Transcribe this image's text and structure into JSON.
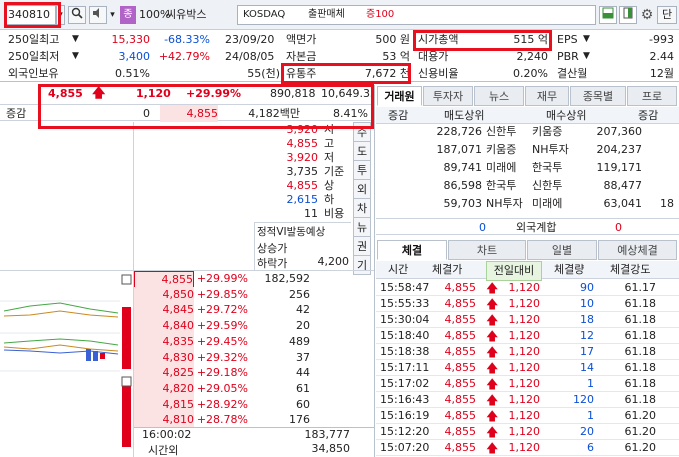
{
  "toolbar": {
    "code": "340810",
    "zoom_badge": "종",
    "zoom": "100%",
    "stock_name": "씨유박스",
    "market": "KOSDAQ",
    "sector": "출판매체",
    "margin": "증100",
    "unit_label": "단"
  },
  "info": {
    "r1": {
      "l1": "250일최고",
      "v1": "15,330",
      "p1": "-68.33%",
      "d1": "23/09/20",
      "l2": "액면가",
      "v2": "500 원",
      "l3": "시가총액",
      "v3": "515 억",
      "l4": "EPS",
      "v4": "-993"
    },
    "r2": {
      "l1": "250일최저",
      "v1": "3,400",
      "p1": "+42.79%",
      "d1": "24/08/05",
      "l2": "자본금",
      "v2": "53 억",
      "l3": "대용가",
      "v3": "2,240",
      "l4": "PBR",
      "v4": "2.44"
    },
    "r3": {
      "l1": "외국인보유",
      "v1": "0.51%",
      "v1b": "55(천)",
      "l2": "유통주",
      "v2": "7,672 천",
      "l3": "신용비율",
      "v3": "0.20%",
      "l4": "결산월",
      "v4": "12월"
    }
  },
  "price": {
    "current": "4,855",
    "change": "1,120",
    "rate": "+29.99%",
    "volume": "890,818",
    "value": "10,649.35",
    "vol_label": "증감",
    "vol_zero": "0",
    "price2": "4,855",
    "amount": "4,182백만",
    "ratio": "8.41%"
  },
  "summary": [
    {
      "v": "3,920",
      "l": "시",
      "c": "red"
    },
    {
      "v": "4,855",
      "l": "고",
      "c": "red"
    },
    {
      "v": "3,920",
      "l": "저",
      "c": "red"
    },
    {
      "v": "3,735",
      "l": "기준",
      "c": "dark"
    },
    {
      "v": "4,855",
      "l": "상",
      "c": "red"
    },
    {
      "v": "2,615",
      "l": "하",
      "c": "blue"
    },
    {
      "v": "11",
      "l": "비용",
      "c": "dark"
    }
  ],
  "vi": {
    "title": "정적VI발동예상",
    "up_label": "상승가",
    "down_label": "하락가",
    "down_value": "4,200"
  },
  "side_tabs": [
    "수",
    "도",
    "투",
    "외",
    "차",
    "뉴",
    "권",
    "기"
  ],
  "asks": [
    {
      "price": "4,855",
      "rate": "+29.99%",
      "qty": "182,592"
    },
    {
      "price": "4,850",
      "rate": "+29.85%",
      "qty": "256"
    },
    {
      "price": "4,845",
      "rate": "+29.72%",
      "qty": "42"
    },
    {
      "price": "4,840",
      "rate": "+29.59%",
      "qty": "20"
    },
    {
      "price": "4,835",
      "rate": "+29.45%",
      "qty": "489"
    },
    {
      "price": "4,830",
      "rate": "+29.32%",
      "qty": "37"
    },
    {
      "price": "4,825",
      "rate": "+29.18%",
      "qty": "44"
    },
    {
      "price": "4,820",
      "rate": "+29.05%",
      "qty": "61"
    },
    {
      "price": "4,815",
      "rate": "+28.92%",
      "qty": "60"
    },
    {
      "price": "4,810",
      "rate": "+28.78%",
      "qty": "176"
    }
  ],
  "ob_footer": {
    "time": "16:00:02",
    "total": "183,777",
    "label": "시간외",
    "after": "34,850"
  },
  "broker_tabs": [
    "거래원",
    "투자자",
    "뉴스",
    "재무",
    "종목별",
    "프로"
  ],
  "broker_header": {
    "left": "증감",
    "sell": "매도상위",
    "buy": "매수상위",
    "right": "증감"
  },
  "brokers": [
    {
      "sq": "228,726",
      "sn": "신한투",
      "bn": "키움증",
      "bq": "207,360",
      "d": ""
    },
    {
      "sq": "187,071",
      "sn": "키움증",
      "bn": "NH투자",
      "bq": "204,237",
      "d": ""
    },
    {
      "sq": "89,741",
      "sn": "미래에",
      "bn": "한국투",
      "bq": "119,171",
      "d": ""
    },
    {
      "sq": "86,598",
      "sn": "한국투",
      "bn": "신한투",
      "bq": "88,477",
      "d": ""
    },
    {
      "sq": "59,703",
      "sn": "NH투자",
      "bn": "미래에",
      "bq": "63,041",
      "d": "18"
    }
  ],
  "foreign_row": {
    "left": "0",
    "label": "외국계합",
    "right": "0"
  },
  "trade_tabs": [
    "체결",
    "차트",
    "일별",
    "예상체결"
  ],
  "trade_header": [
    "시간",
    "체결가",
    "전일대비",
    "체결량",
    "체결강도"
  ],
  "trades": [
    {
      "t": "15:58:47",
      "p": "4,855",
      "d": "1,120",
      "q": "90",
      "s": "61.17"
    },
    {
      "t": "15:55:33",
      "p": "4,855",
      "d": "1,120",
      "q": "10",
      "s": "61.18"
    },
    {
      "t": "15:30:04",
      "p": "4,855",
      "d": "1,120",
      "q": "18",
      "s": "61.18"
    },
    {
      "t": "15:18:40",
      "p": "4,855",
      "d": "1,120",
      "q": "12",
      "s": "61.18"
    },
    {
      "t": "15:18:38",
      "p": "4,855",
      "d": "1,120",
      "q": "17",
      "s": "61.18"
    },
    {
      "t": "15:17:11",
      "p": "4,855",
      "d": "1,120",
      "q": "14",
      "s": "61.18"
    },
    {
      "t": "15:17:02",
      "p": "4,855",
      "d": "1,120",
      "q": "1",
      "s": "61.18"
    },
    {
      "t": "15:16:43",
      "p": "4,855",
      "d": "1,120",
      "q": "120",
      "s": "61.18"
    },
    {
      "t": "15:16:19",
      "p": "4,855",
      "d": "1,120",
      "q": "1",
      "s": "61.20"
    },
    {
      "t": "15:12:20",
      "p": "4,855",
      "d": "1,120",
      "q": "20",
      "s": "61.20"
    },
    {
      "t": "15:07:20",
      "p": "4,855",
      "d": "1,120",
      "q": "6",
      "s": "61.20"
    }
  ],
  "colors": {
    "up": "#e0001b",
    "down": "#0a4fd6",
    "highlight": "#e8101f"
  }
}
